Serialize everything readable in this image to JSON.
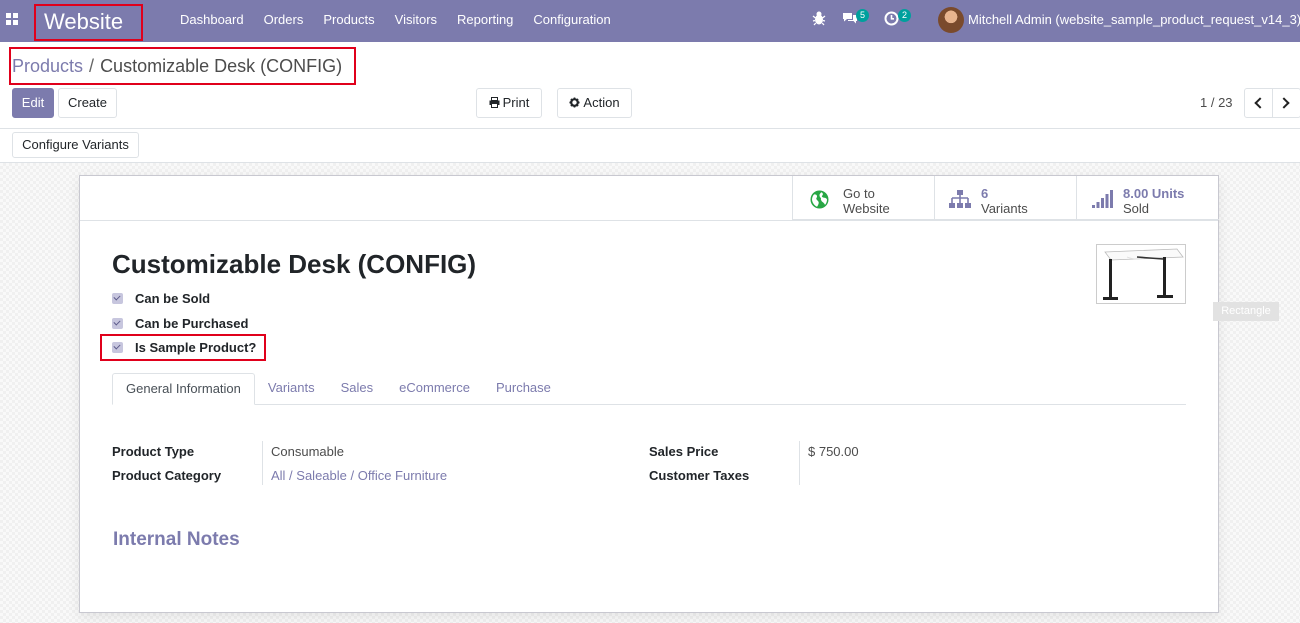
{
  "navbar": {
    "app_name": "Website",
    "menu": [
      "Dashboard",
      "Orders",
      "Products",
      "Visitors",
      "Reporting",
      "Configuration"
    ],
    "messages_count": "5",
    "activities_count": "2",
    "user": "Mitchell Admin (website_sample_product_request_v14_3)"
  },
  "breadcrumb": {
    "parent": "Products",
    "separator": "/",
    "current": "Customizable Desk (CONFIG)"
  },
  "toolbar": {
    "edit": "Edit",
    "create": "Create",
    "print": "Print",
    "action": "Action",
    "pager": "1 / 23"
  },
  "statusbar": {
    "configure_variants": "Configure Variants"
  },
  "smart_buttons": {
    "website": {
      "line1": "Go to",
      "line2": "Website"
    },
    "variants": {
      "value": "6",
      "label": "Variants"
    },
    "sold": {
      "value": "8.00 Units",
      "label": "Sold"
    }
  },
  "product": {
    "name": "Customizable Desk (CONFIG)",
    "image_tooltip": "Rectangle",
    "checks": {
      "can_be_sold": "Can be Sold",
      "can_be_purchased": "Can be Purchased",
      "is_sample": "Is Sample Product?"
    }
  },
  "tabs": [
    "General Information",
    "Variants",
    "Sales",
    "eCommerce",
    "Purchase"
  ],
  "fields": {
    "product_type_label": "Product Type",
    "product_type_value": "Consumable",
    "product_category_label": "Product Category",
    "product_category_value": "All / Saleable / Office Furniture",
    "sales_price_label": "Sales Price",
    "sales_price_value": "$ 750.00",
    "customer_taxes_label": "Customer Taxes"
  },
  "internal_notes": "Internal Notes",
  "colors": {
    "brand": "#7c7bad",
    "badge": "#00a09d",
    "highlight": "#e0001b"
  }
}
